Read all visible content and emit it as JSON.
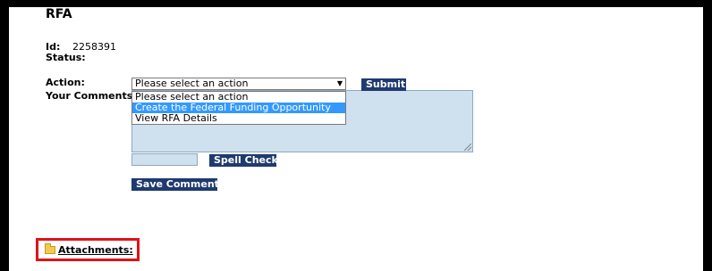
{
  "header": {
    "title": "RFA"
  },
  "record": {
    "id_label": "Id:",
    "id_value": "2258391",
    "status_label": "Status:"
  },
  "form": {
    "action_label": "Action:",
    "comments_label": "Your Comments:",
    "select_value": "Please select an action",
    "options": [
      "Please select an action",
      "Create the Federal Funding Opportunity",
      "View RFA Details"
    ],
    "highlighted_option": "Create the Federal Funding Opportunity",
    "submit_label": "Submit",
    "spell_check_label": "Spell Check",
    "save_comment_label": "Save Comment"
  },
  "attachments": {
    "label": "Attachments:"
  },
  "colors": {
    "button_bg": "#1f3a6e",
    "input_bg": "#cfe0ef",
    "highlight": "#3399ff",
    "callout_border": "#e0131a"
  },
  "icons": {
    "attachments_icon": "folder-icon",
    "select_caret": "caret-down-icon"
  }
}
